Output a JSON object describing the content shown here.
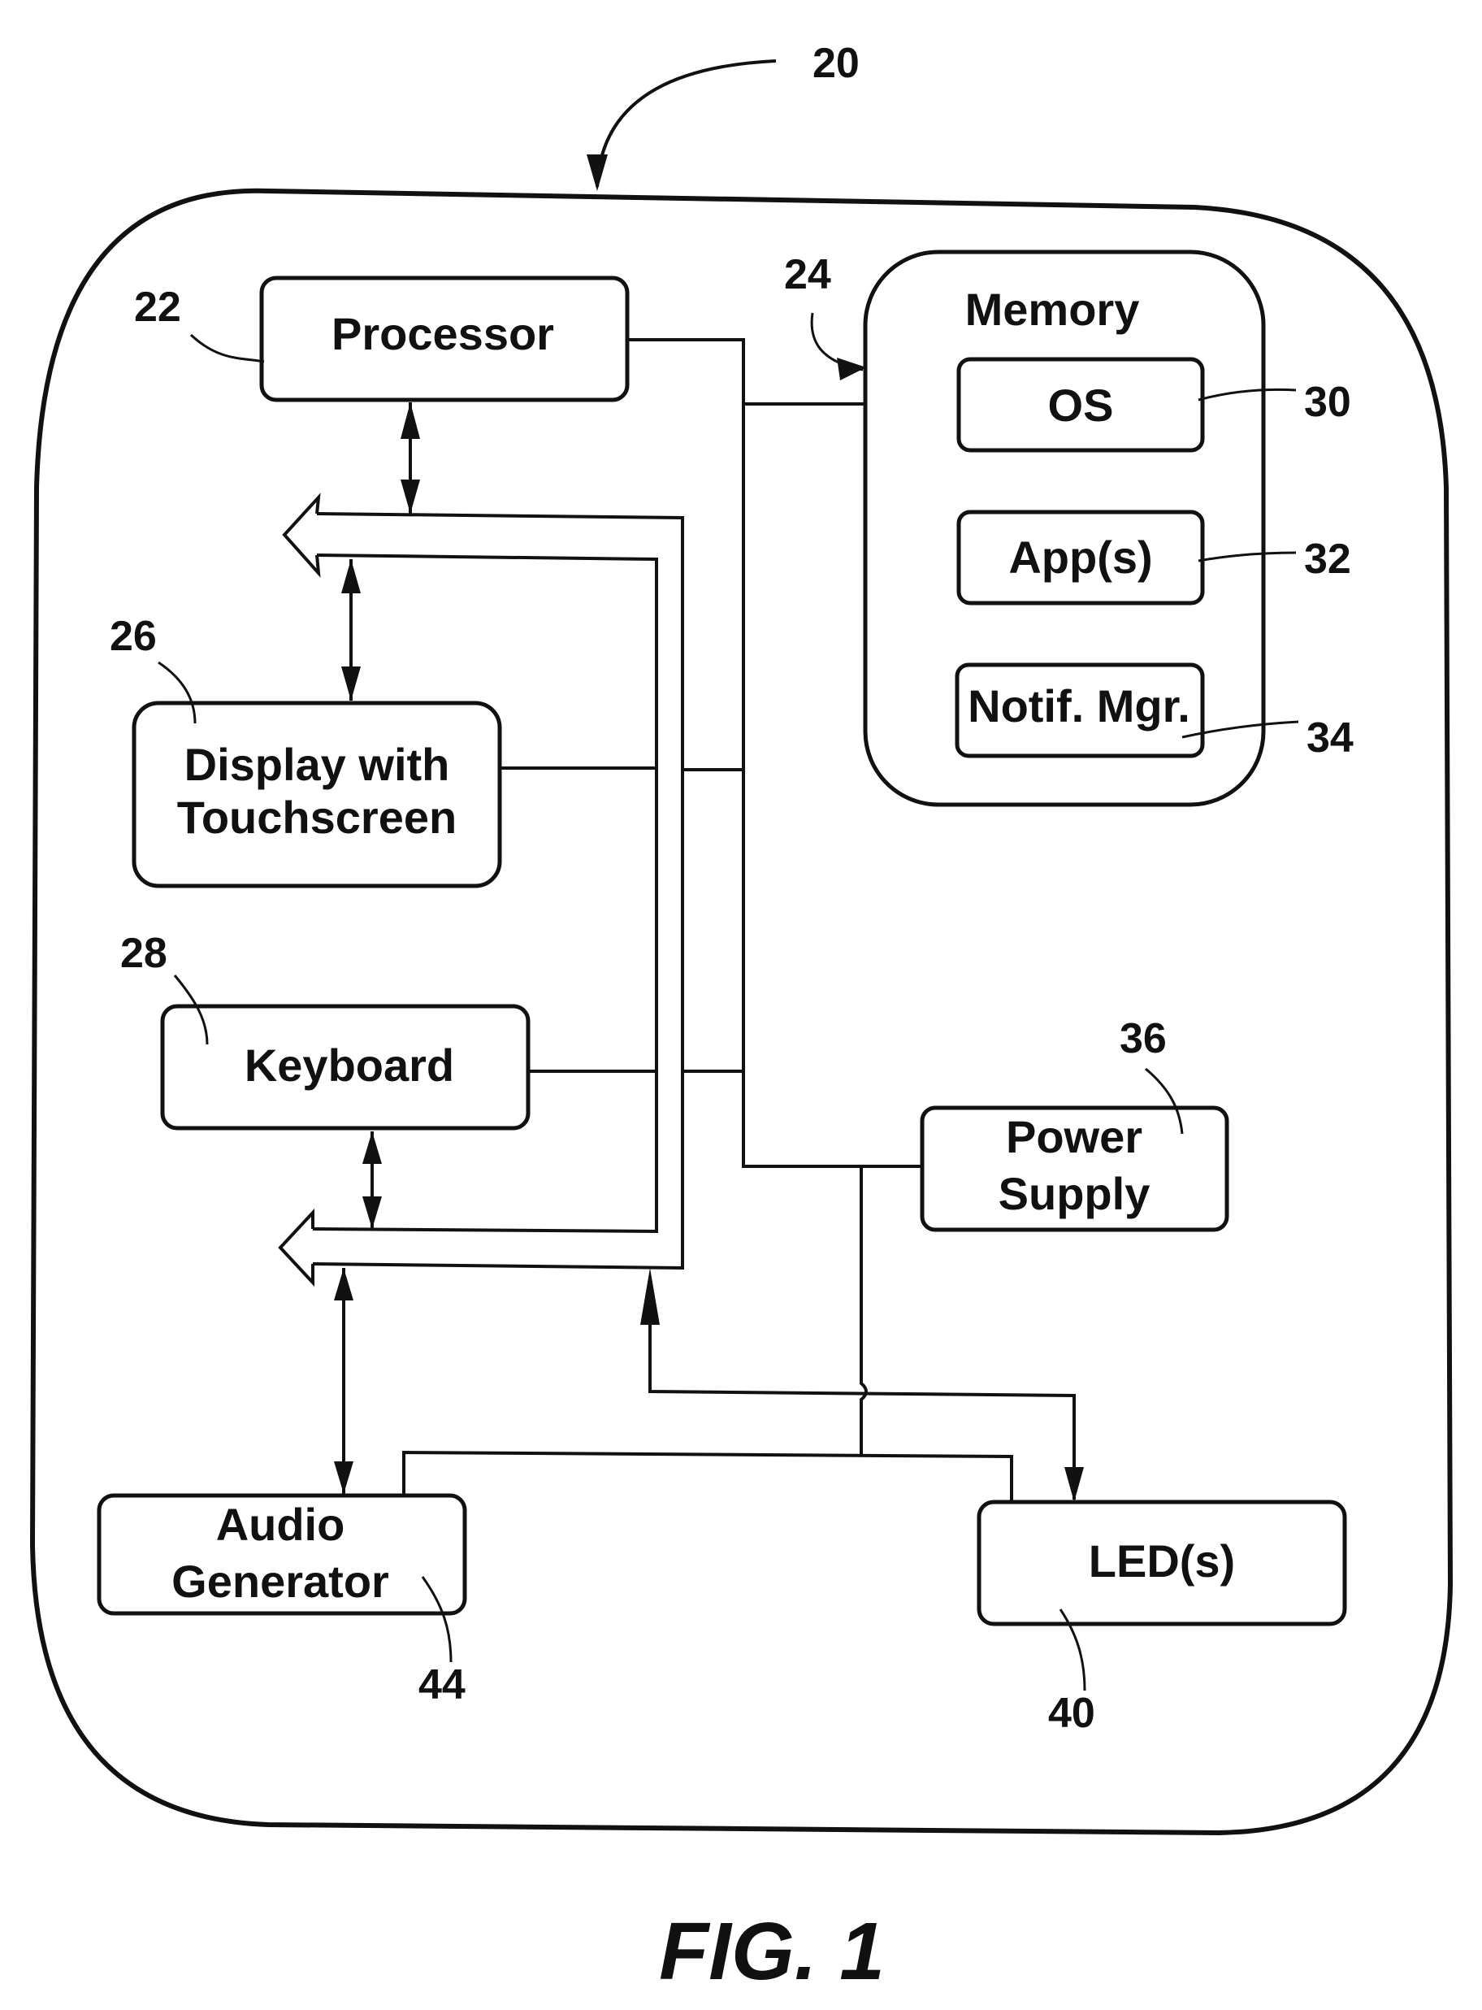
{
  "figure": {
    "caption": "FIG. 1",
    "device_ref": "20"
  },
  "components": {
    "processor": {
      "label": "Processor",
      "ref": "22"
    },
    "memory": {
      "label": "Memory",
      "ref": "24"
    },
    "display": {
      "label_line1": "Display with",
      "label_line2": "Touchscreen",
      "ref": "26"
    },
    "keyboard": {
      "label": "Keyboard",
      "ref": "28"
    },
    "os": {
      "label": "OS",
      "ref": "30"
    },
    "apps": {
      "label": "App(s)",
      "ref": "32"
    },
    "notif_mgr": {
      "label": "Notif. Mgr.",
      "ref": "34"
    },
    "power_supply": {
      "label_line1": "Power",
      "label_line2": "Supply",
      "ref": "36"
    },
    "leds": {
      "label": "LED(s)",
      "ref": "40"
    },
    "audio_generator": {
      "label_line1": "Audio",
      "label_line2": "Generator",
      "ref": "44"
    }
  }
}
